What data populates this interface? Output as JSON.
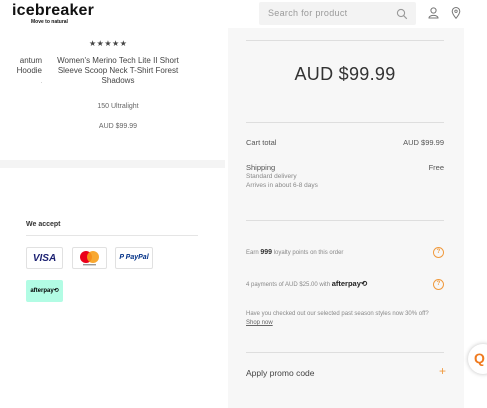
{
  "header": {
    "brand": "icebreaker",
    "tagline": "Move to natural",
    "search_placeholder": "Search for product",
    "icons": [
      "search-icon",
      "user-icon",
      "location-pin-icon"
    ]
  },
  "product": {
    "rating_stars": "★★★★★",
    "name": "Women's Merino Tech Lite II Short Sleeve Scoop Neck T-Shirt Forest Shadows",
    "clipped_name": "antum\nHoodie",
    "variant": "150 Ultralight",
    "price": "AUD $99.99"
  },
  "payments": {
    "title": "We accept",
    "methods": [
      "VISA",
      "Mastercard",
      "P PayPal",
      "afterpay⟲"
    ]
  },
  "summary": {
    "grand_total": "AUD $99.99",
    "cart_total_label": "Cart total",
    "cart_total_value": "AUD $99.99",
    "shipping_label": "Shipping",
    "shipping_value": "Free",
    "shipping_method": "Standard delivery",
    "shipping_eta": "Arrives in about 6-8 days",
    "loyalty_prefix": "Earn",
    "loyalty_points": "999",
    "loyalty_suffix": "loyalty points on this order",
    "afterpay_text": "4 payments of AUD $25.00 with",
    "afterpay_brand": "afterpay⟲",
    "promo_text": "Have you checked out our selected past season styles now 30% off?",
    "promo_link": "Shop now",
    "promo_code_label": "Apply promo code",
    "promo_code_icon": "+"
  },
  "colors": {
    "accent": "#f09a3e",
    "afterpay_mint": "#b2fce4",
    "panel_bg": "#f4f4f4"
  }
}
